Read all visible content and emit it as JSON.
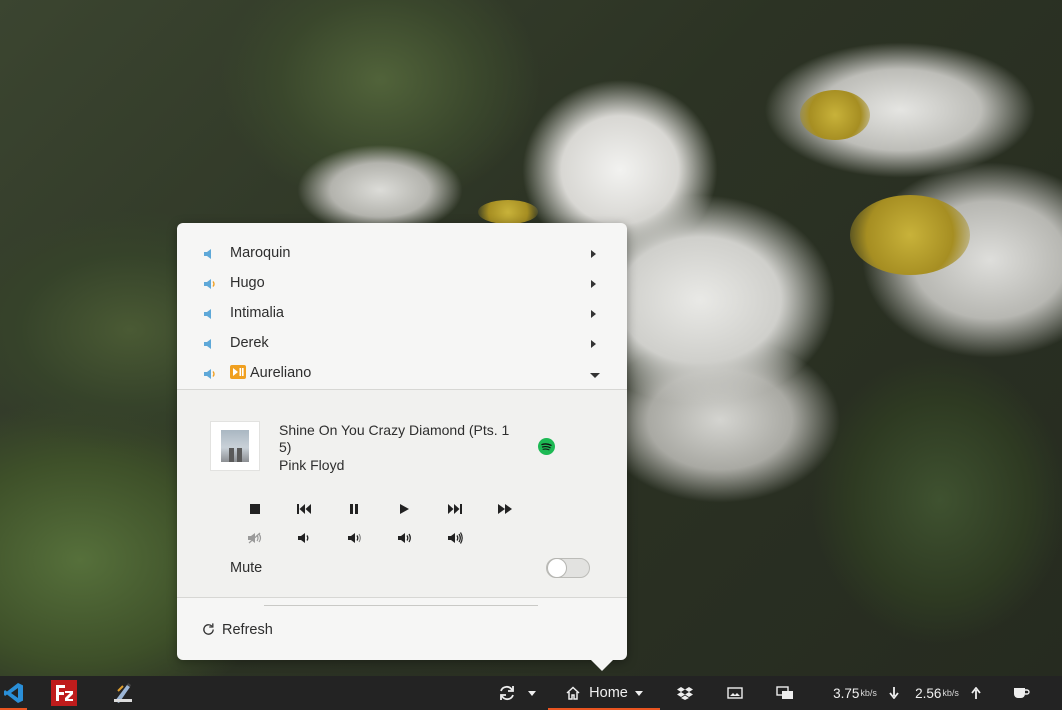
{
  "sound_menu": {
    "devices": [
      {
        "label": "Maroquin",
        "expanded": false,
        "playing": false
      },
      {
        "label": "Hugo",
        "expanded": false,
        "playing": false
      },
      {
        "label": "Intimalia",
        "expanded": false,
        "playing": false
      },
      {
        "label": "Derek",
        "expanded": false,
        "playing": false
      },
      {
        "label": "Aureliano",
        "expanded": true,
        "playing": true
      }
    ],
    "now_playing": {
      "title": "Shine On You Crazy Diamond (Pts. 1 5)",
      "artist": "Pink Floyd",
      "source_icon": "spotify-icon",
      "source_color": "#1db954"
    },
    "controls": [
      "stop-icon",
      "previous-icon",
      "pause-icon",
      "play-icon",
      "next-icon",
      "fast-forward-icon"
    ],
    "volume_presets": [
      "volume-muted-icon",
      "volume-low-icon",
      "volume-medium-icon",
      "volume-high-icon",
      "volume-max-icon"
    ],
    "mute": {
      "label": "Mute",
      "enabled": false
    },
    "refresh_label": "Refresh"
  },
  "taskbar": {
    "launchers": [
      "vscode-icon",
      "filezilla-icon",
      "text-editor-icon"
    ],
    "places_label": "Home",
    "net_down": {
      "value": "3.75",
      "unit": "kb/s"
    },
    "net_up": {
      "value": "2.56",
      "unit": "kb/s"
    },
    "accent_color": "#e95420"
  }
}
